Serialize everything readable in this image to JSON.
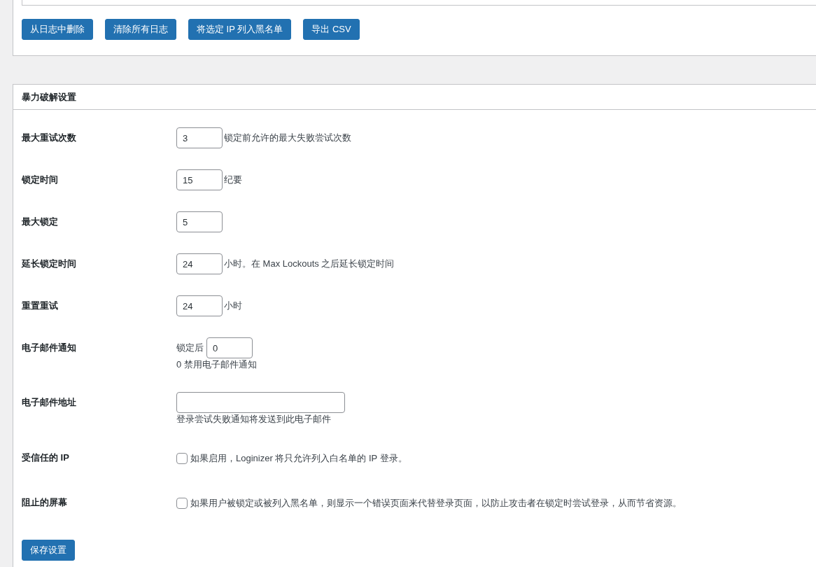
{
  "log_actions": {
    "buttons": [
      "从日志中删除",
      "清除所有日志",
      "将选定 IP 列入黑名单",
      "导出 CSV"
    ]
  },
  "brute_force": {
    "title": "暴力破解设置",
    "rows": [
      {
        "kind": "input",
        "label": "最大重试次数",
        "value": "3",
        "suffix": "锁定前允许的最大失败尝试次数"
      },
      {
        "kind": "input",
        "label": "锁定时间",
        "value": "15",
        "suffix": "纪要"
      },
      {
        "kind": "input",
        "label": "最大锁定",
        "value": "5"
      },
      {
        "kind": "input",
        "label": "延长锁定时间",
        "value": "24",
        "suffix": "小时。在 Max Lockouts 之后延长锁定时间"
      },
      {
        "kind": "input",
        "label": "重置重试",
        "value": "24",
        "suffix": "小时"
      },
      {
        "kind": "input",
        "label": "电子邮件通知",
        "prefix": "锁定后",
        "value": "0",
        "note": "0 禁用电子邮件通知"
      },
      {
        "kind": "wide-input",
        "label": "电子邮件地址",
        "note": "登录尝试失败通知将发送到此电子邮件"
      },
      {
        "kind": "checkbox",
        "label": "受信任的 IP",
        "checked": false,
        "description": "如果启用，Loginizer 将只允许列入白名单的 IP 登录。"
      },
      {
        "kind": "checkbox",
        "label": "阻止的屏幕",
        "checked": false,
        "description": "如果用户被锁定或被列入黑名单，则显示一个错误页面来代替登录页面，以防止攻击者在锁定时尝试登录，从而节省资源。"
      }
    ],
    "save_button": "保存设置"
  }
}
